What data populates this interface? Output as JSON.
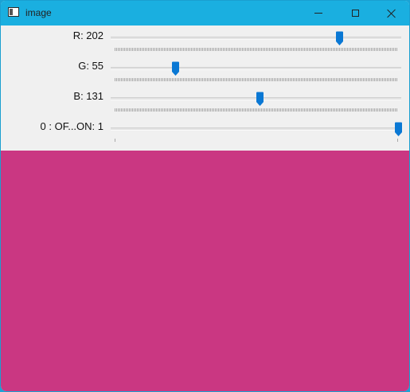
{
  "window": {
    "title": "image",
    "accent": "#1aafe0",
    "minimize_icon": "minimize-icon",
    "maximize_icon": "maximize-icon",
    "close_icon": "close-icon"
  },
  "sliders": [
    {
      "label": "R: 202",
      "value": 202,
      "max": 255,
      "ticks": "dense"
    },
    {
      "label": "G: 55",
      "value": 55,
      "max": 255,
      "ticks": "dense"
    },
    {
      "label": "B: 131",
      "value": 131,
      "max": 255,
      "ticks": "dense"
    },
    {
      "label": "0 : OF...ON: 1",
      "value": 1,
      "max": 1,
      "ticks": "sparse"
    }
  ],
  "thumb_color": "#0a78d4",
  "image": {
    "color": "#ca3782"
  }
}
